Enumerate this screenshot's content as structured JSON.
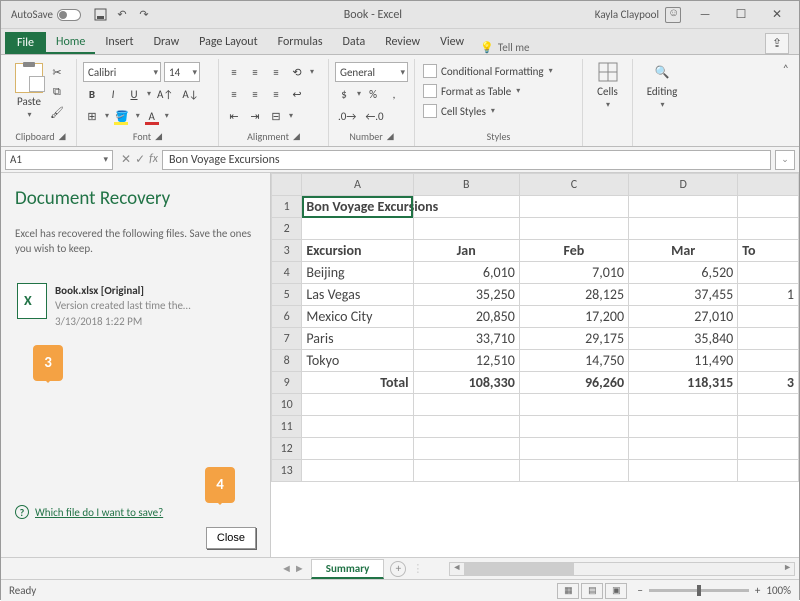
{
  "titlebar": {
    "autosave_label": "AutoSave",
    "title": "Book - Excel",
    "user": "Kayla Claypool"
  },
  "menu": {
    "file": "File",
    "items": [
      "Home",
      "Insert",
      "Draw",
      "Page Layout",
      "Formulas",
      "Data",
      "Review",
      "View"
    ],
    "active": "Home",
    "tellme": "Tell me"
  },
  "ribbon": {
    "clipboard": {
      "paste": "Paste",
      "label": "Clipboard"
    },
    "font": {
      "name": "Calibri",
      "size": "14",
      "label": "Font"
    },
    "alignment": {
      "label": "Alignment"
    },
    "number": {
      "format": "General",
      "label": "Number"
    },
    "styles": {
      "cond": "Conditional Formatting",
      "table": "Format as Table",
      "cell": "Cell Styles",
      "label": "Styles"
    },
    "cells": {
      "label": "Cells"
    },
    "editing": {
      "label": "Editing"
    }
  },
  "formula_bar": {
    "cellref": "A1",
    "value": "Bon Voyage Excursions"
  },
  "recovery": {
    "title": "Document Recovery",
    "desc": "Excel has recovered the following files.  Save the ones you wish to keep.",
    "file_name": "Book.xlsx  [Original]",
    "file_sub": "Version created last time the…",
    "file_time": "3/13/2018 1:22 PM",
    "help_link": "Which file do I want to save?",
    "close": "Close"
  },
  "callouts": {
    "c3": "3",
    "c4": "4"
  },
  "sheet": {
    "columns": [
      "A",
      "B",
      "C",
      "D",
      ""
    ],
    "rows": [
      {
        "n": 1,
        "cells": [
          "Bon Voyage Excursions",
          "",
          "",
          "",
          ""
        ],
        "merged_title": true
      },
      {
        "n": 2,
        "cells": [
          "",
          "",
          "",
          "",
          ""
        ]
      },
      {
        "n": 3,
        "cells": [
          "Excursion",
          "Jan",
          "Feb",
          "Mar",
          "To"
        ],
        "bold": true,
        "center_from": 1
      },
      {
        "n": 4,
        "cells": [
          "Beijing",
          "6,010",
          "7,010",
          "6,520",
          ""
        ]
      },
      {
        "n": 5,
        "cells": [
          "Las Vegas",
          "35,250",
          "28,125",
          "37,455",
          "1"
        ]
      },
      {
        "n": 6,
        "cells": [
          "Mexico City",
          "20,850",
          "17,200",
          "27,010",
          ""
        ]
      },
      {
        "n": 7,
        "cells": [
          "Paris",
          "33,710",
          "29,175",
          "35,840",
          ""
        ]
      },
      {
        "n": 8,
        "cells": [
          "Tokyo",
          "12,510",
          "14,750",
          "11,490",
          ""
        ]
      },
      {
        "n": 9,
        "cells": [
          "Total",
          "108,330",
          "96,260",
          "118,315",
          "3"
        ],
        "bold": true,
        "total": true
      },
      {
        "n": 10,
        "cells": [
          "",
          "",
          "",
          "",
          ""
        ]
      },
      {
        "n": 11,
        "cells": [
          "",
          "",
          "",
          "",
          ""
        ]
      },
      {
        "n": 12,
        "cells": [
          "",
          "",
          "",
          "",
          ""
        ]
      },
      {
        "n": 13,
        "cells": [
          "",
          "",
          "",
          "",
          ""
        ]
      }
    ],
    "active_tab": "Summary"
  },
  "statusbar": {
    "status": "Ready",
    "zoom": "100%"
  },
  "chart_data": {
    "type": "table",
    "title": "Bon Voyage Excursions",
    "columns": [
      "Excursion",
      "Jan",
      "Feb",
      "Mar"
    ],
    "rows": [
      [
        "Beijing",
        6010,
        7010,
        6520
      ],
      [
        "Las Vegas",
        35250,
        28125,
        37455
      ],
      [
        "Mexico City",
        20850,
        17200,
        27010
      ],
      [
        "Paris",
        33710,
        29175,
        35840
      ],
      [
        "Tokyo",
        12510,
        14750,
        11490
      ]
    ],
    "totals": [
      "Total",
      108330,
      96260,
      118315
    ]
  }
}
